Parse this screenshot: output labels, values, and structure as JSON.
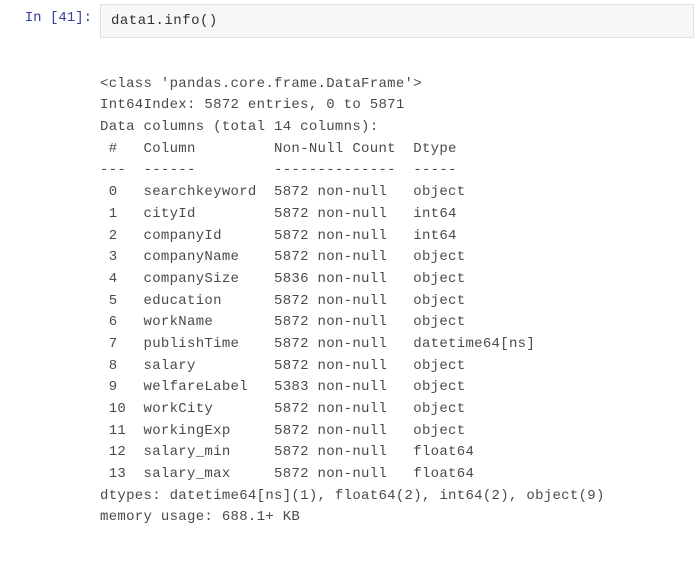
{
  "prompt": {
    "in_label": "In  [41]:",
    "code": "data1.info()"
  },
  "output": {
    "class_line": "<class 'pandas.core.frame.DataFrame'>",
    "index_line": "Int64Index: 5872 entries, 0 to 5871",
    "cols_line": "Data columns (total 14 columns):",
    "header": " #   Column         Non-Null Count  Dtype",
    "divider": "---  ------         --------------  -----",
    "rows": [
      " 0   searchkeyword  5872 non-null   object",
      " 1   cityId         5872 non-null   int64",
      " 2   companyId      5872 non-null   int64",
      " 3   companyName    5872 non-null   object",
      " 4   companySize    5836 non-null   object",
      " 5   education      5872 non-null   object",
      " 6   workName       5872 non-null   object",
      " 7   publishTime    5872 non-null   datetime64[ns]",
      " 8   salary         5872 non-null   object",
      " 9   welfareLabel   5383 non-null   object",
      " 10  workCity       5872 non-null   object",
      " 11  workingExp     5872 non-null   object",
      " 12  salary_min     5872 non-null   float64",
      " 13  salary_max     5872 non-null   float64"
    ],
    "dtypes_line": "dtypes: datetime64[ns](1), float64(2), int64(2), object(9)",
    "memory_line": "memory usage: 688.1+ KB"
  }
}
